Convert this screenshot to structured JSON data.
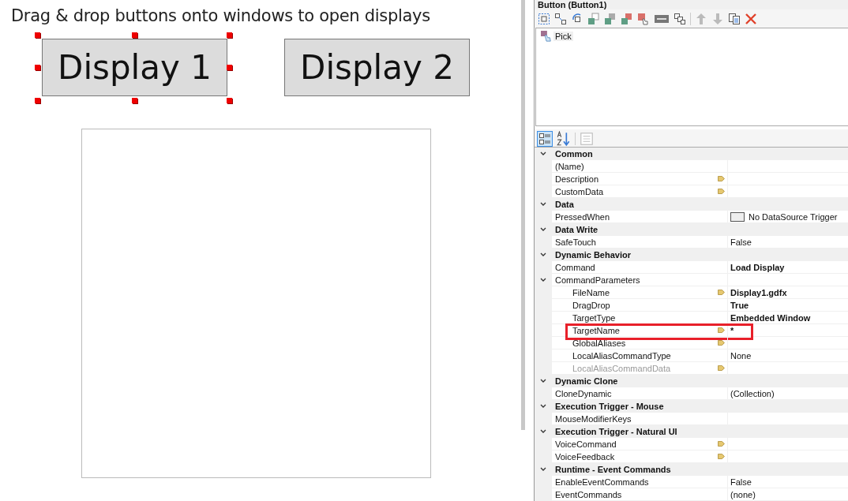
{
  "canvas": {
    "instruction": "Drag & drop buttons onto windows to open displays",
    "buttons": [
      {
        "label": "Display 1",
        "selected": true
      },
      {
        "label": "Display 2",
        "selected": false
      }
    ]
  },
  "panel": {
    "title": "Button (Button1)",
    "events": [
      {
        "label": "Pick"
      }
    ],
    "categories": [
      {
        "name": "Common",
        "expanded": true,
        "properties": [
          {
            "name": "(Name)",
            "bound": false,
            "disabled": false,
            "highlighted": false
          },
          {
            "name": "Description",
            "bound": true,
            "disabled": false,
            "highlighted": false
          },
          {
            "name": "CustomData",
            "bound": true,
            "disabled": false,
            "highlighted": false
          }
        ]
      },
      {
        "name": "Data",
        "expanded": true,
        "properties": [
          {
            "name": "PressedWhen",
            "value": "No DataSource Trigger",
            "swatch": true,
            "bound": false,
            "modified": false,
            "disabled": false,
            "highlighted": false
          }
        ]
      },
      {
        "name": "Data Write",
        "expanded": true,
        "properties": [
          {
            "name": "SafeTouch",
            "value": "False",
            "bound": false,
            "modified": false,
            "disabled": false,
            "highlighted": false
          }
        ]
      },
      {
        "name": "Dynamic Behavior",
        "expanded": true,
        "properties": [
          {
            "name": "Command",
            "value": "Load Display",
            "bound": false,
            "modified": true,
            "disabled": false,
            "highlighted": false
          },
          {
            "name": "CommandParameters",
            "expanded": true,
            "bound": false,
            "disabled": false,
            "highlighted": false,
            "children": [
              {
                "name": "FileName",
                "value": "Display1.gdfx",
                "bound": true,
                "modified": true,
                "disabled": false,
                "highlighted": false
              },
              {
                "name": "DragDrop",
                "value": "True",
                "bound": false,
                "modified": true,
                "disabled": false,
                "highlighted": false
              },
              {
                "name": "TargetType",
                "value": "Embedded Window",
                "bound": false,
                "modified": true,
                "disabled": false,
                "highlighted": false
              },
              {
                "name": "TargetName",
                "value": "*",
                "bound": true,
                "modified": true,
                "disabled": false,
                "highlighted": true
              },
              {
                "name": "GlobalAliases",
                "bound": true,
                "disabled": false,
                "highlighted": false
              },
              {
                "name": "LocalAliasCommandType",
                "value": "None",
                "bound": false,
                "modified": false,
                "disabled": false,
                "highlighted": false
              },
              {
                "name": "LocalAliasCommandData",
                "bound": true,
                "disabled": true,
                "highlighted": false
              }
            ]
          }
        ]
      },
      {
        "name": "Dynamic Clone",
        "expanded": true,
        "properties": [
          {
            "name": "CloneDynamic",
            "value": "(Collection)",
            "bound": false,
            "modified": false,
            "disabled": false,
            "highlighted": false
          }
        ]
      },
      {
        "name": "Execution Trigger - Mouse",
        "expanded": true,
        "properties": [
          {
            "name": "MouseModifierKeys",
            "bound": false,
            "disabled": false,
            "highlighted": false
          }
        ]
      },
      {
        "name": "Execution Trigger - Natural UI",
        "expanded": true,
        "properties": [
          {
            "name": "VoiceCommand",
            "bound": true,
            "disabled": false,
            "highlighted": false
          },
          {
            "name": "VoiceFeedback",
            "bound": true,
            "disabled": false,
            "highlighted": false
          }
        ]
      },
      {
        "name": "Runtime - Event Commands",
        "expanded": true,
        "properties": [
          {
            "name": "EnableEventCommands",
            "value": "False",
            "bound": false,
            "modified": false,
            "disabled": false,
            "highlighted": false
          },
          {
            "name": "EventCommands",
            "value": "(none)",
            "bound": false,
            "modified": false,
            "disabled": false,
            "highlighted": false
          }
        ]
      }
    ]
  }
}
